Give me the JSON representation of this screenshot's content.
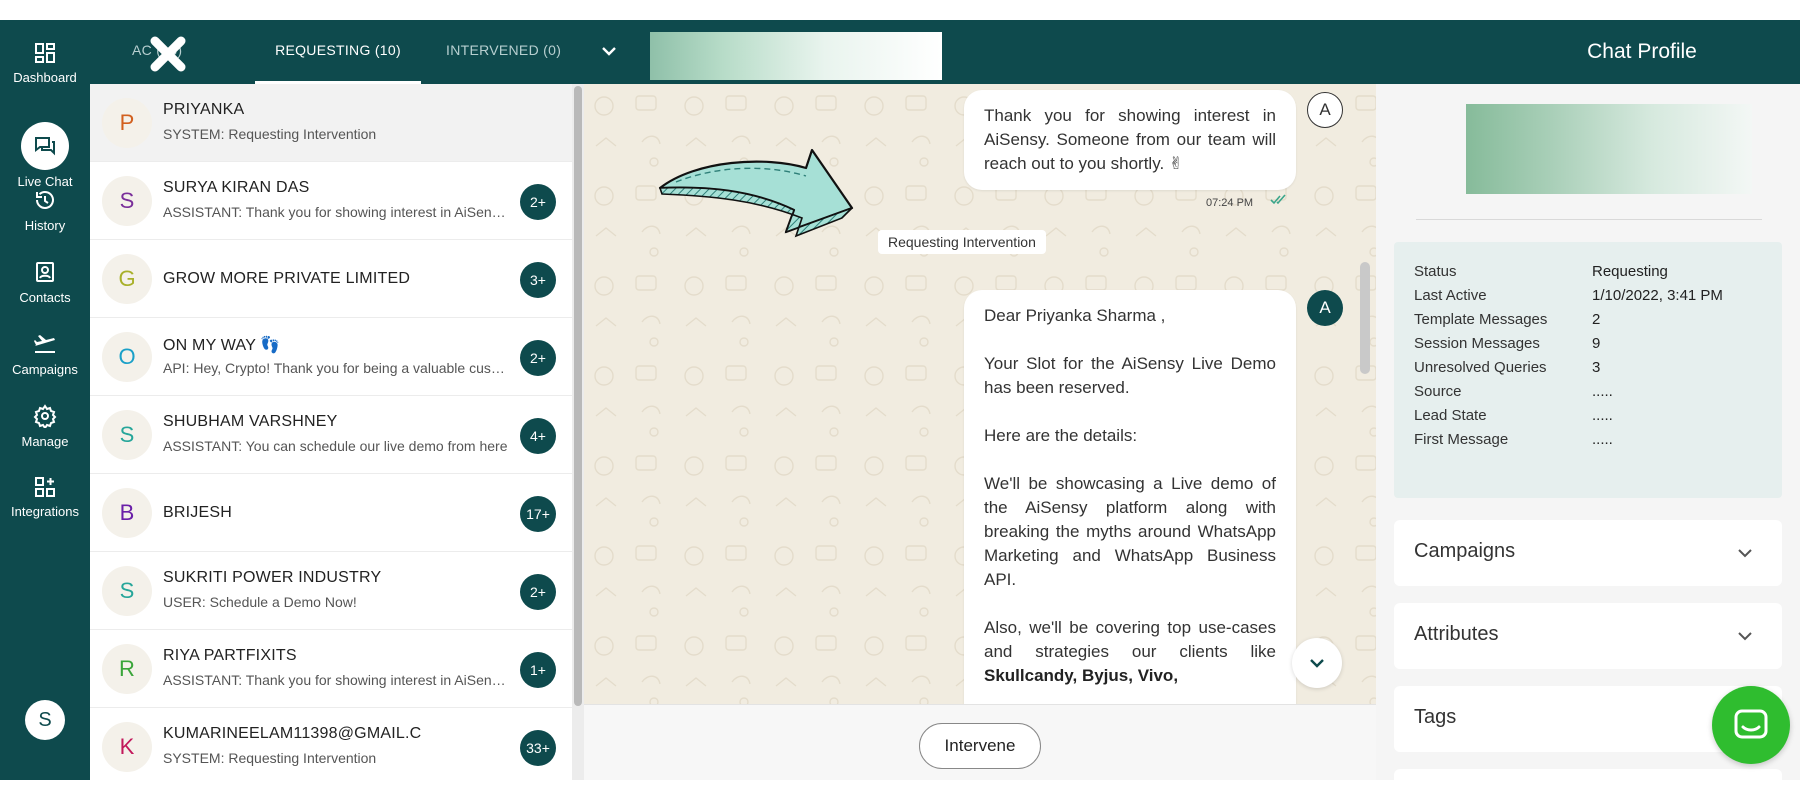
{
  "nav": {
    "items": [
      {
        "label": "Dashboard",
        "icon": "dashboard-icon"
      },
      {
        "label": "Live Chat",
        "icon": "chat-icon"
      },
      {
        "label": "History",
        "icon": "history-icon"
      },
      {
        "label": "Contacts",
        "icon": "contacts-icon"
      },
      {
        "label": "Campaigns",
        "icon": "plane-icon"
      },
      {
        "label": "Manage",
        "icon": "gear-icon"
      },
      {
        "label": "Integrations",
        "icon": "integrations-icon"
      }
    ],
    "avatar": "S"
  },
  "tabs": [
    {
      "label": "AC (13)"
    },
    {
      "label": "REQUESTING (10)"
    },
    {
      "label": "INTERVENED (0)"
    }
  ],
  "profile_title": "Chat Profile",
  "chats": [
    {
      "initial": "P",
      "color": "#d2601f",
      "name": "PRIYANKA",
      "preview": "SYSTEM: Requesting Intervention",
      "badge": ""
    },
    {
      "initial": "S",
      "color": "#7a2f9a",
      "name": "SURYA KIRAN DAS",
      "preview": "ASSISTANT: Thank you for showing interest in AiSensy. Someone from our team",
      "badge": "2+"
    },
    {
      "initial": "G",
      "color": "#a8b02a",
      "name": "GROW MORE PRIVATE LIMITED",
      "preview": "",
      "badge": "3+"
    },
    {
      "initial": "O",
      "color": "#1aa0c8",
      "name": "ON MY WAY 👣",
      "preview": "API: Hey, Crypto! Thank you for being a valuable customer",
      "badge": "2+"
    },
    {
      "initial": "S",
      "color": "#26a69a",
      "name": "SHUBHAM VARSHNEY",
      "preview": "ASSISTANT: You can schedule our live demo from here",
      "badge": "4+"
    },
    {
      "initial": "B",
      "color": "#6a1fa8",
      "name": "BRIJESH",
      "preview": "",
      "badge": "17+"
    },
    {
      "initial": "S",
      "color": "#26a69a",
      "name": "SUKRITI POWER INDUSTRY",
      "preview": "USER: Schedule a Demo Now!",
      "badge": "2+"
    },
    {
      "initial": "R",
      "color": "#3aa53a",
      "name": "RIYA PARTFIXITS",
      "preview": "ASSISTANT: Thank you for showing interest in AiSensy. Someone from our team",
      "badge": "1+"
    },
    {
      "initial": "K",
      "color": "#c2185b",
      "name": "KUMARINEELAM11398@GMAIL.C",
      "preview": "SYSTEM: Requesting Intervention",
      "badge": "33+"
    }
  ],
  "conversation": {
    "msg1": "Thank you for showing interest in AiSensy. Someone from our team will reach out to you shortly. ✌",
    "msg1_time": "07:24 PM",
    "agent_initial_1": "A",
    "system_pill": "Requesting Intervention",
    "agent_initial_2": "A",
    "msg2": {
      "p1": "Dear Priyanka Sharma ,",
      "p2": "Your Slot for the AiSensy Live Demo has been reserved.",
      "p3": "Here are the details:",
      "p4": "We'll be showcasing a Live demo of the AiSensy platform along with breaking the myths around WhatsApp Marketing and WhatsApp Business API.",
      "p5_start": "Also, we'll be covering top use-cases and strategies our clients like ",
      "b1": "Skullcandy,",
      "b2": "Byjus,",
      "b3": "Vivo,"
    },
    "intervene_label": "Intervene"
  },
  "profile": {
    "rows": [
      {
        "label": "Status",
        "value": "Requesting"
      },
      {
        "label": "Last Active",
        "value": "1/10/2022, 3:41 PM"
      },
      {
        "label": "Template Messages",
        "value": "2"
      },
      {
        "label": "Session Messages",
        "value": "9"
      },
      {
        "label": "Unresolved Queries",
        "value": "3"
      },
      {
        "label": "Source",
        "value": "....."
      },
      {
        "label": "Lead State",
        "value": "....."
      },
      {
        "label": "First Message",
        "value": "....."
      }
    ],
    "accordions": [
      {
        "label": "Campaigns"
      },
      {
        "label": "Attributes"
      },
      {
        "label": "Tags"
      }
    ]
  },
  "colors": {
    "brand": "#0e4a4d",
    "accent_arrow": "#a6e0d6",
    "help_button": "#2fbd2f"
  }
}
